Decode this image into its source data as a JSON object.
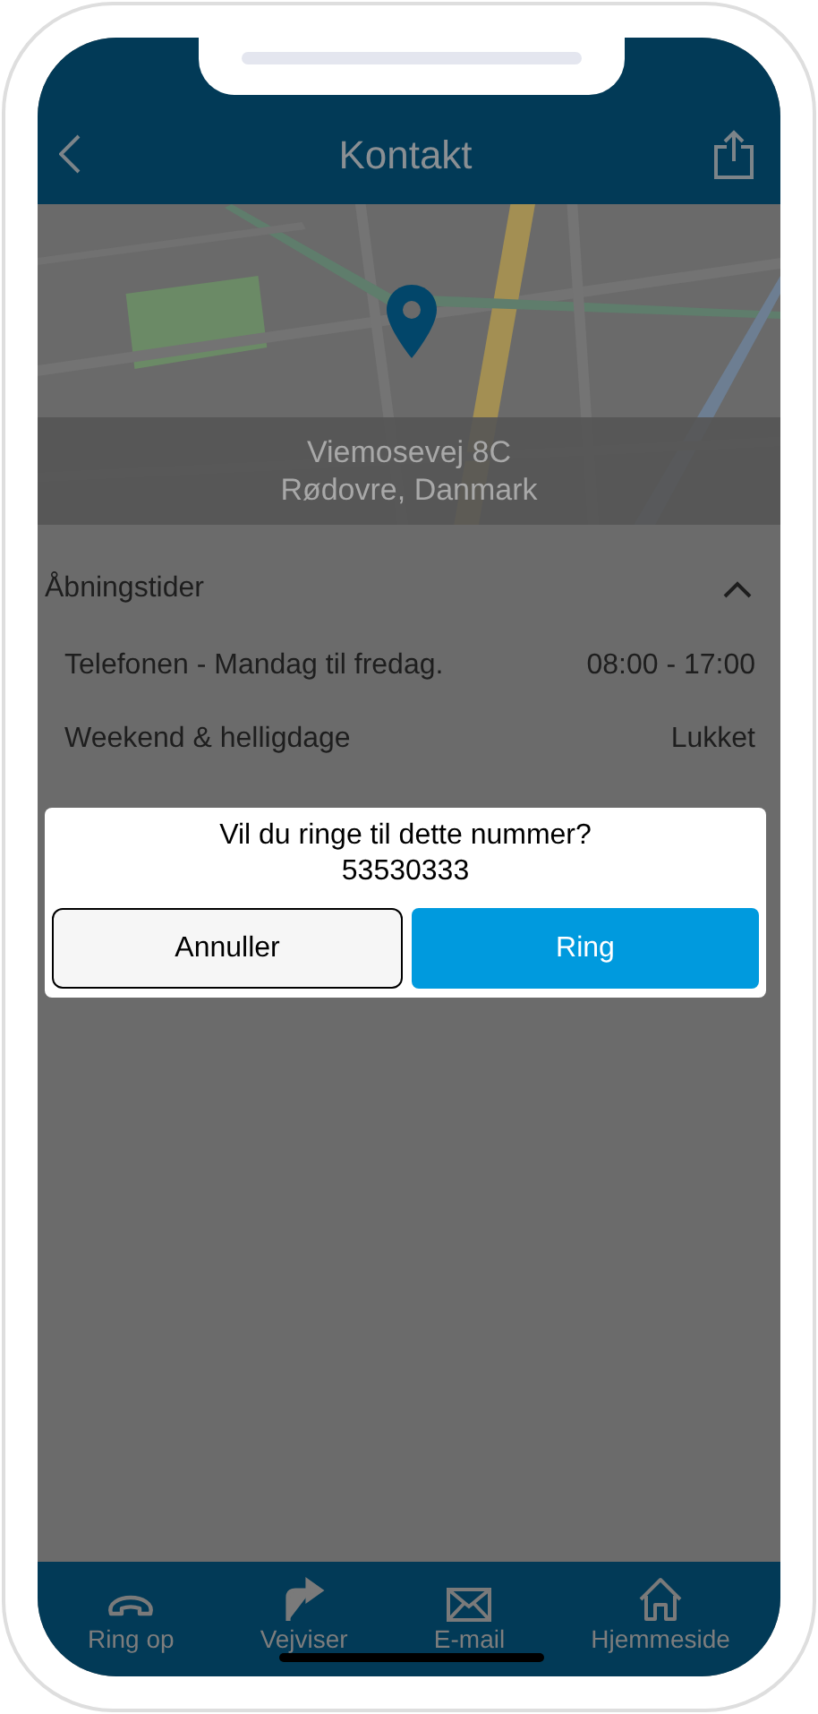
{
  "header": {
    "title": "Kontakt"
  },
  "map": {
    "address_line_1": "Viemosevej 8C",
    "address_line_2": "Rødovre, Danmark"
  },
  "opening_hours": {
    "title": "Åbningstider",
    "expanded": true,
    "rows": [
      {
        "label": "Telefonen - Mandag til fredag.",
        "value": "08:00 - 17:00"
      },
      {
        "label": "Weekend & helligdage",
        "value": "Lukket"
      }
    ]
  },
  "dialog": {
    "message": "Vil du ringe til dette nummer?",
    "number": "53530333",
    "buttons": [
      {
        "label": "Annuller",
        "kind": "secondary"
      },
      {
        "label": "Ring",
        "kind": "primary"
      }
    ]
  },
  "tab_bar": [
    {
      "label": "Ring op",
      "kind": "phone"
    },
    {
      "label": "Vejviser",
      "kind": "directions"
    },
    {
      "label": "E-mail",
      "kind": "mail"
    },
    {
      "label": "Hjemmeside",
      "kind": "home"
    }
  ]
}
